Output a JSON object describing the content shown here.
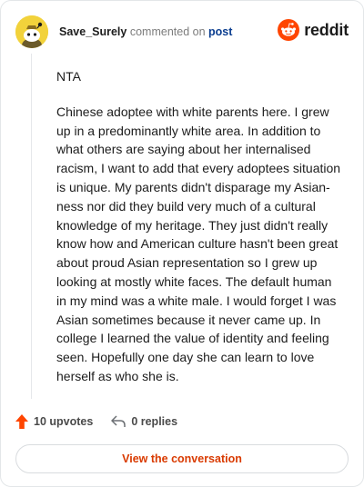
{
  "comment": {
    "username": "Save_Surely",
    "action_text": "commented on",
    "post_link": "post",
    "body": [
      "NTA",
      "Chinese adoptee with white parents here. I grew up in a predominantly white area. In addition to what others are saying about her internalised racism, I want to add that every adoptees situation is unique. My parents didn't disparage my Asian-ness nor did they build very much of a cultural knowledge of my heritage. They just didn't really know how and American culture hasn't been great about proud Asian representation so I grew up looking at mostly white faces. The default human in my mind was a white male. I would forget I was Asian sometimes because it never came up. In college I learned the value of identity and feeling seen. Hopefully one day she can learn to love herself as who she is."
    ],
    "upvotes": "10 upvotes",
    "replies": "0 replies"
  },
  "brand": {
    "name": "reddit",
    "logo": "reddit-logo-icon"
  },
  "cta": {
    "label": "View the conversation"
  },
  "colors": {
    "brand_orange": "#ff4500",
    "upvote": "#ff4500",
    "link_blue": "#0a3d8f",
    "cta_text": "#d93a00",
    "avatar_bg": "#f2d23b"
  }
}
